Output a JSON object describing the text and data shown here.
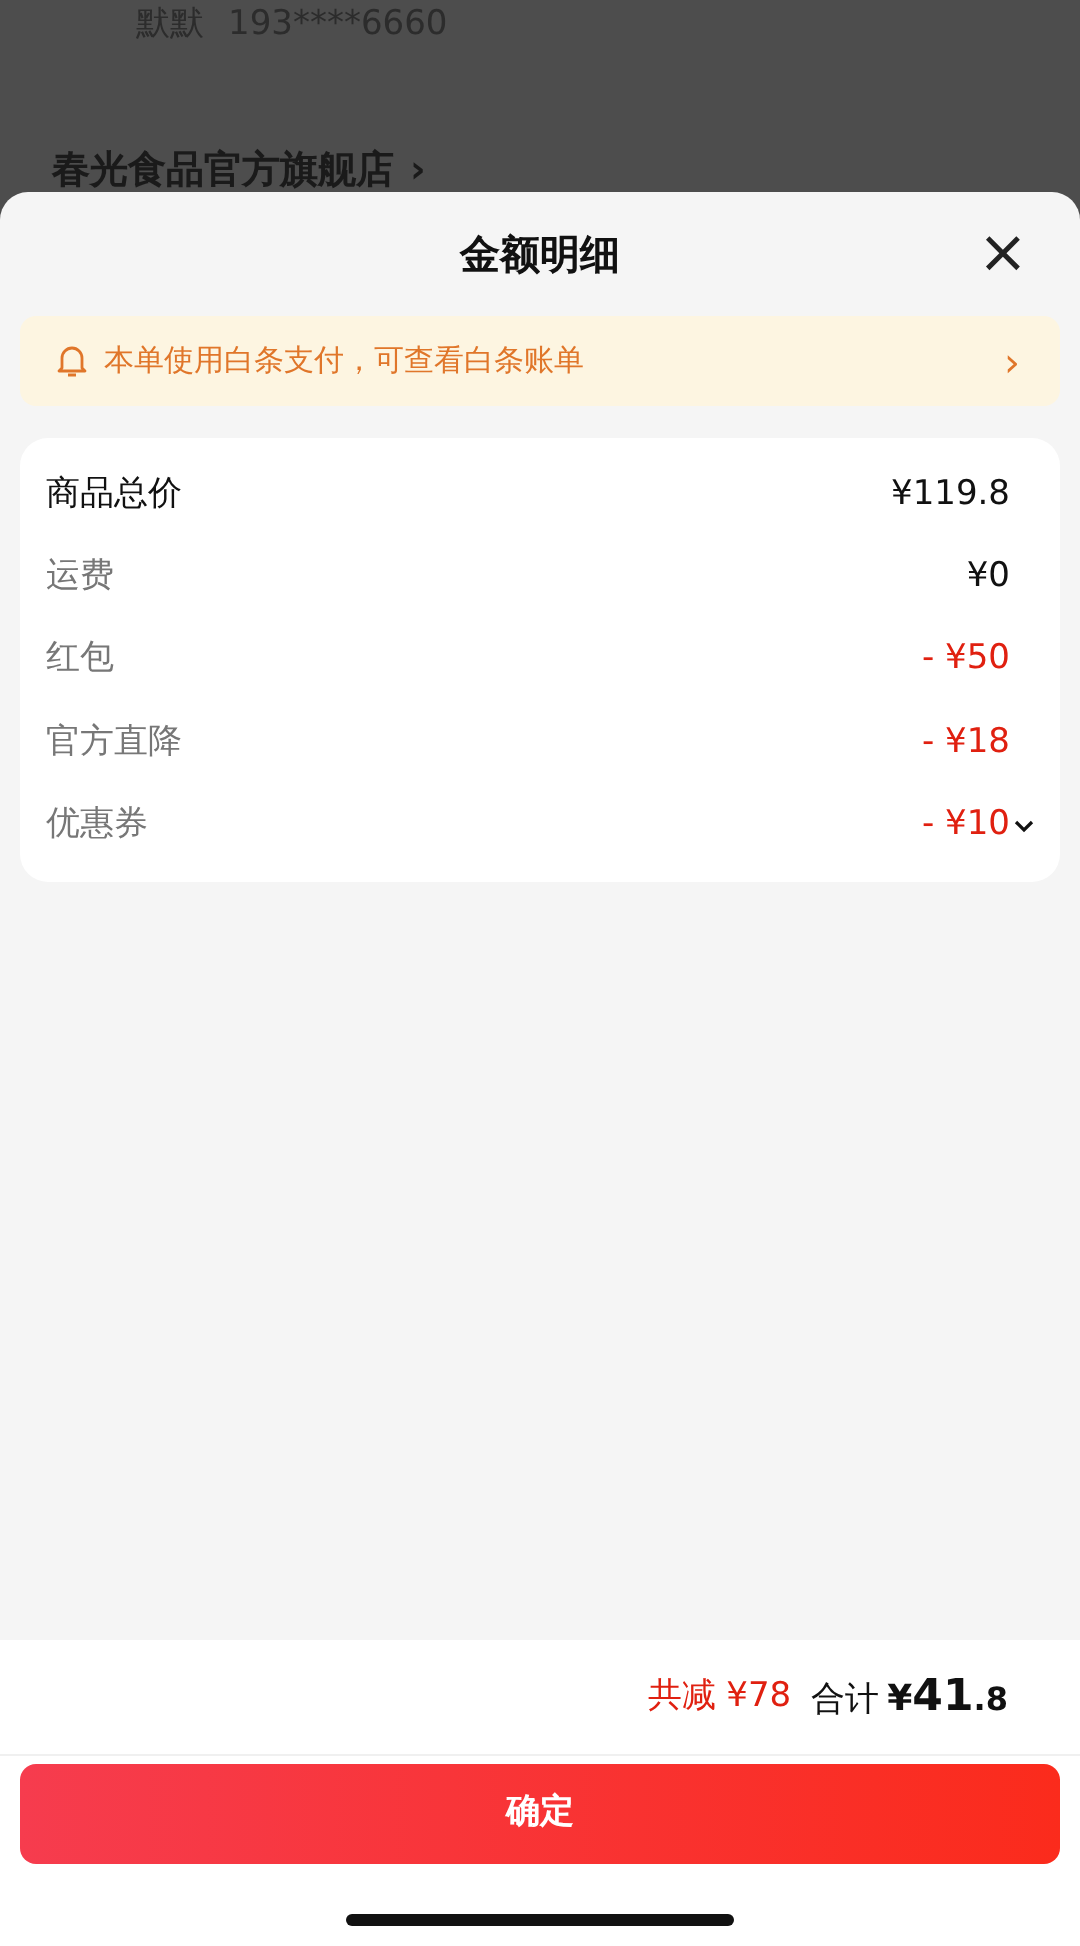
{
  "background": {
    "contact_name": "默默",
    "contact_phone": "193****6660",
    "store_name": "春光食品官方旗舰店",
    "store_chevron": "›"
  },
  "sheet": {
    "title": "金额明细",
    "close": "×"
  },
  "notice": {
    "text": "本单使用白条支付，可查看白条账单",
    "chevron": "›"
  },
  "rows": [
    {
      "kind": "subtotal",
      "label": "商品总价",
      "amount": "¥119.8"
    },
    {
      "kind": "fee",
      "label": "运费",
      "amount": "¥0"
    },
    {
      "kind": "discount",
      "label": "红包",
      "amount": "- ¥50"
    },
    {
      "kind": "discount",
      "label": "官方直降",
      "amount": "- ¥18"
    },
    {
      "kind": "coupon",
      "label": "优惠券",
      "amount": "- ¥10"
    }
  ],
  "footer": {
    "saving": "共减 ¥78",
    "total_label": "合计",
    "total_currency": "¥",
    "total_integer": "41",
    "total_decimal": ".8",
    "confirm": "确定"
  }
}
